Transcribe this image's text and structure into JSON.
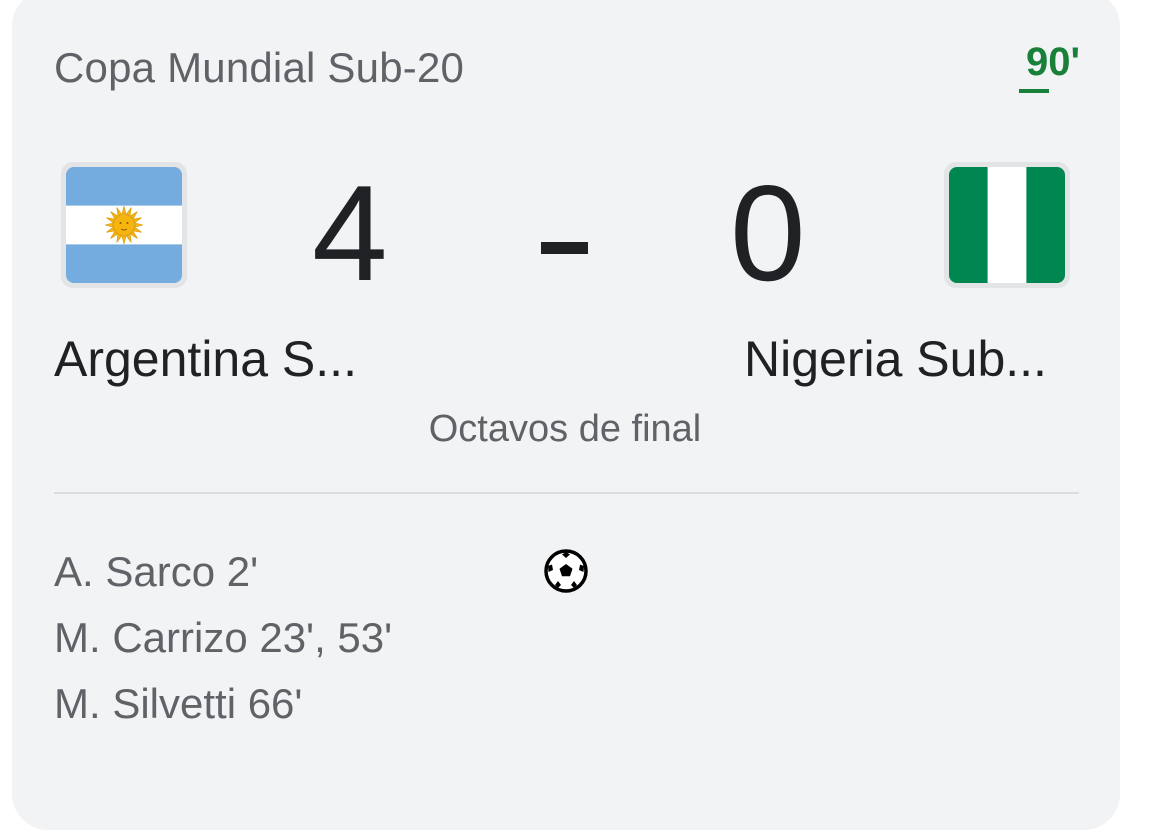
{
  "header": {
    "competition": "Copa Mundial Sub-20",
    "minute": "90'"
  },
  "match": {
    "home": {
      "name": "Argentina S...",
      "score": "4",
      "flag_icon": "argentina-flag-icon",
      "colors": [
        "#74acdf",
        "#ffffff",
        "#f6b40e"
      ]
    },
    "away": {
      "name": "Nigeria Sub...",
      "score": "0",
      "flag_icon": "nigeria-flag-icon",
      "colors": [
        "#008751",
        "#ffffff"
      ]
    },
    "stage": "Octavos de final"
  },
  "goals": {
    "icon": "soccer-ball-icon",
    "home_scorers": [
      "A. Sarco 2'",
      "M. Carrizo 23', 53'",
      "M. Silvetti 66'"
    ]
  },
  "colors": {
    "live_accent": "#188038",
    "card_background": "#f2f3f5",
    "primary_text": "#202124",
    "secondary_text": "#5f6368"
  }
}
